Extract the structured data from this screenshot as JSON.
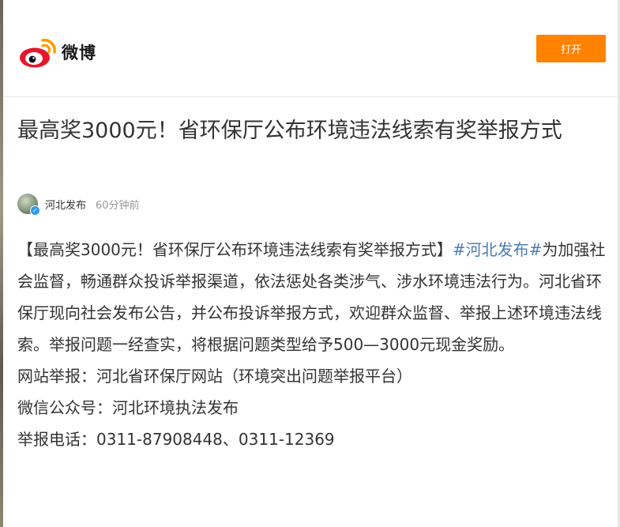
{
  "header": {
    "logo_text": "微博",
    "open_button_label": "打开"
  },
  "article": {
    "title": "最高奖3000元！省环保厅公布环境违法线索有奖举报方式",
    "author": "河北发布",
    "time": "60分钟前",
    "lead_text": "【最高奖3000元！省环保厅公布环境违法线索有奖举报方式】",
    "hashtag": "#河北发布#",
    "body": "为加强社会监督，畅通群众投诉举报渠道，依法惩处各类涉气、涉水环境违法行为。河北省环保厅现向社会发布公告，并公布投诉举报方式，欢迎群众监督、举报上述环境违法线索。举报问题一经查实，将根据问题类型给予500—3000元现金奖励。",
    "lines": [
      "网站举报：河北省环保厅网站（环境突出问题举报平台）",
      "微信公众号：河北环境执法发布",
      "举报电话：0311-87908448、0311-12369"
    ]
  },
  "colors": {
    "accent": "#ff8200",
    "link": "#4a7db3"
  }
}
